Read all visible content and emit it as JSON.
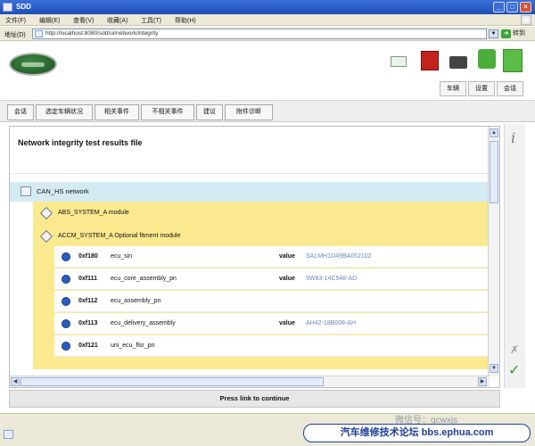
{
  "window": {
    "title": "SDD",
    "buttons": {
      "minimize": "_",
      "maximize": "□",
      "close": "×"
    }
  },
  "menubar": {
    "items": [
      "文件(F)",
      "编辑(E)",
      "查看(V)",
      "收藏(A)",
      "工具(T)",
      "帮助(H)"
    ]
  },
  "addressbar": {
    "label": "地址(D)",
    "url": "http://localhost:8080/sdd/ui/network/integrity",
    "go_label": "转到"
  },
  "header": {
    "tabs": [
      "车辆",
      "设置",
      "会话"
    ]
  },
  "main_tabs": [
    "会话",
    "选定车辆状况",
    "相关事件",
    "不相关事件",
    "建议",
    "附件诊断"
  ],
  "content": {
    "title": "Network integrity test results file",
    "network": "CAN_HS network",
    "modules": [
      "ABS_SYSTEM_A module",
      "ACCM_SYSTEM_A Optional fitment module"
    ],
    "value_label": "value",
    "params": [
      {
        "id": "0xf180",
        "name": "ecu_sin",
        "value": "SALMH1D49BA052102"
      },
      {
        "id": "0xf111",
        "name": "ecu_core_assembly_pn",
        "value": "9W83-14C548-AD"
      },
      {
        "id": "0xf112",
        "name": "ecu_assembly_pn",
        "value": ""
      },
      {
        "id": "0xf113",
        "name": "ecu_delivery_assembly",
        "value": "AH42-18B008-AH"
      },
      {
        "id": "0xf121",
        "name": "uni_ecu_flsr_pn",
        "value": ""
      }
    ]
  },
  "press_link": "Press link to continue",
  "sidebar": {
    "info": "i",
    "cancel": "✗",
    "confirm": "✓"
  },
  "watermark": {
    "wechat": "微信号：qcwxjs",
    "forum": "汽车维修技术论坛 bbs.ephua.com"
  }
}
